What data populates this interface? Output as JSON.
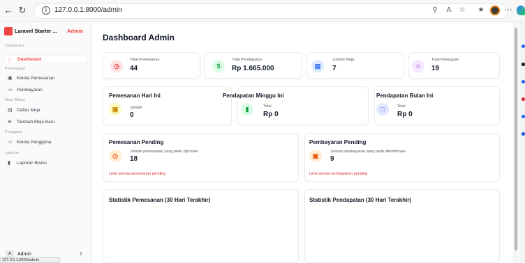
{
  "browser": {
    "url": "127.0.0.1:8000/admin",
    "status_url": "127.0.0.1:8000/admin"
  },
  "sidebar": {
    "brand_name": "Laravel Starter ...",
    "brand_tag": "Admin",
    "sections": {
      "dashboard": "Dashboard",
      "pemesanan": "Pemesanan",
      "meja": "Meja Biliard",
      "pengguna": "Pengguna",
      "laporan": "Laporan"
    },
    "items": [
      {
        "label": "Dashboard",
        "icon": "home-icon"
      },
      {
        "label": "Kelola Pemesanan",
        "icon": "calendar-icon"
      },
      {
        "label": "Pembayaran",
        "icon": "credit-card-icon"
      },
      {
        "label": "Daftar Meja",
        "icon": "table-icon"
      },
      {
        "label": "Tambah Meja Baru",
        "icon": "plus-circle-icon"
      },
      {
        "label": "Kelola Pengguna",
        "icon": "users-icon"
      },
      {
        "label": "Laporan Bisnis",
        "icon": "bar-chart-icon"
      }
    ],
    "user": {
      "avatar": "A",
      "name": "Admin"
    }
  },
  "main": {
    "title": "Dashboard Admin",
    "stats": [
      {
        "label": "Total Pemesanan",
        "value": "44",
        "icon": "clock-icon",
        "color": "#ef4444",
        "bg": "#fee2e2"
      },
      {
        "label": "Total Pendapatan",
        "value": "Rp 1.665.000",
        "icon": "dollar-icon",
        "color": "#16a34a",
        "bg": "#dcfce7"
      },
      {
        "label": "Jumlah Meja",
        "value": "7",
        "icon": "table-icon",
        "color": "#2563eb",
        "bg": "#dbeafe"
      },
      {
        "label": "Total Pelanggan",
        "value": "19",
        "icon": "users-icon",
        "color": "#9333ea",
        "bg": "#f3e8ff"
      }
    ],
    "periods": [
      {
        "title": "Pemesanan Hari Ini",
        "label": "Jumlah",
        "value": "0",
        "icon": "calendar-icon",
        "color": "#ca8a04",
        "bg": "#fef9c3"
      },
      {
        "title": "Pendapatan Minggu Ini",
        "label": "Total",
        "value": "Rp 0",
        "icon": "chart-icon",
        "color": "#16a34a",
        "bg": "#dcfce7"
      },
      {
        "title": "Pendapatan Bulan Ini",
        "label": "Total",
        "value": "Rp 0",
        "icon": "document-icon",
        "color": "#4f46e5",
        "bg": "#e0e7ff"
      }
    ],
    "pending": [
      {
        "title": "Pemesanan Pending",
        "label": "Jumlah pemesanan yang perlu diproses",
        "value": "18",
        "link": "Lihat semua pemesanan pending",
        "icon": "clock-icon",
        "color": "#ea580c",
        "bg": "#ffedd5"
      },
      {
        "title": "Pembayaran Pending",
        "label": "Jumlah pembayaran yang perlu dikonfirmasi",
        "value": "9",
        "link": "Lihat semua pembayaran pending",
        "icon": "card-icon",
        "color": "#ea580c",
        "bg": "#ffedd5"
      }
    ],
    "charts": [
      {
        "title": "Statistik Pemesanan (30 Hari Terakhir)"
      },
      {
        "title": "Statistik Pendapatan (30 Hari Terakhir)"
      }
    ]
  }
}
